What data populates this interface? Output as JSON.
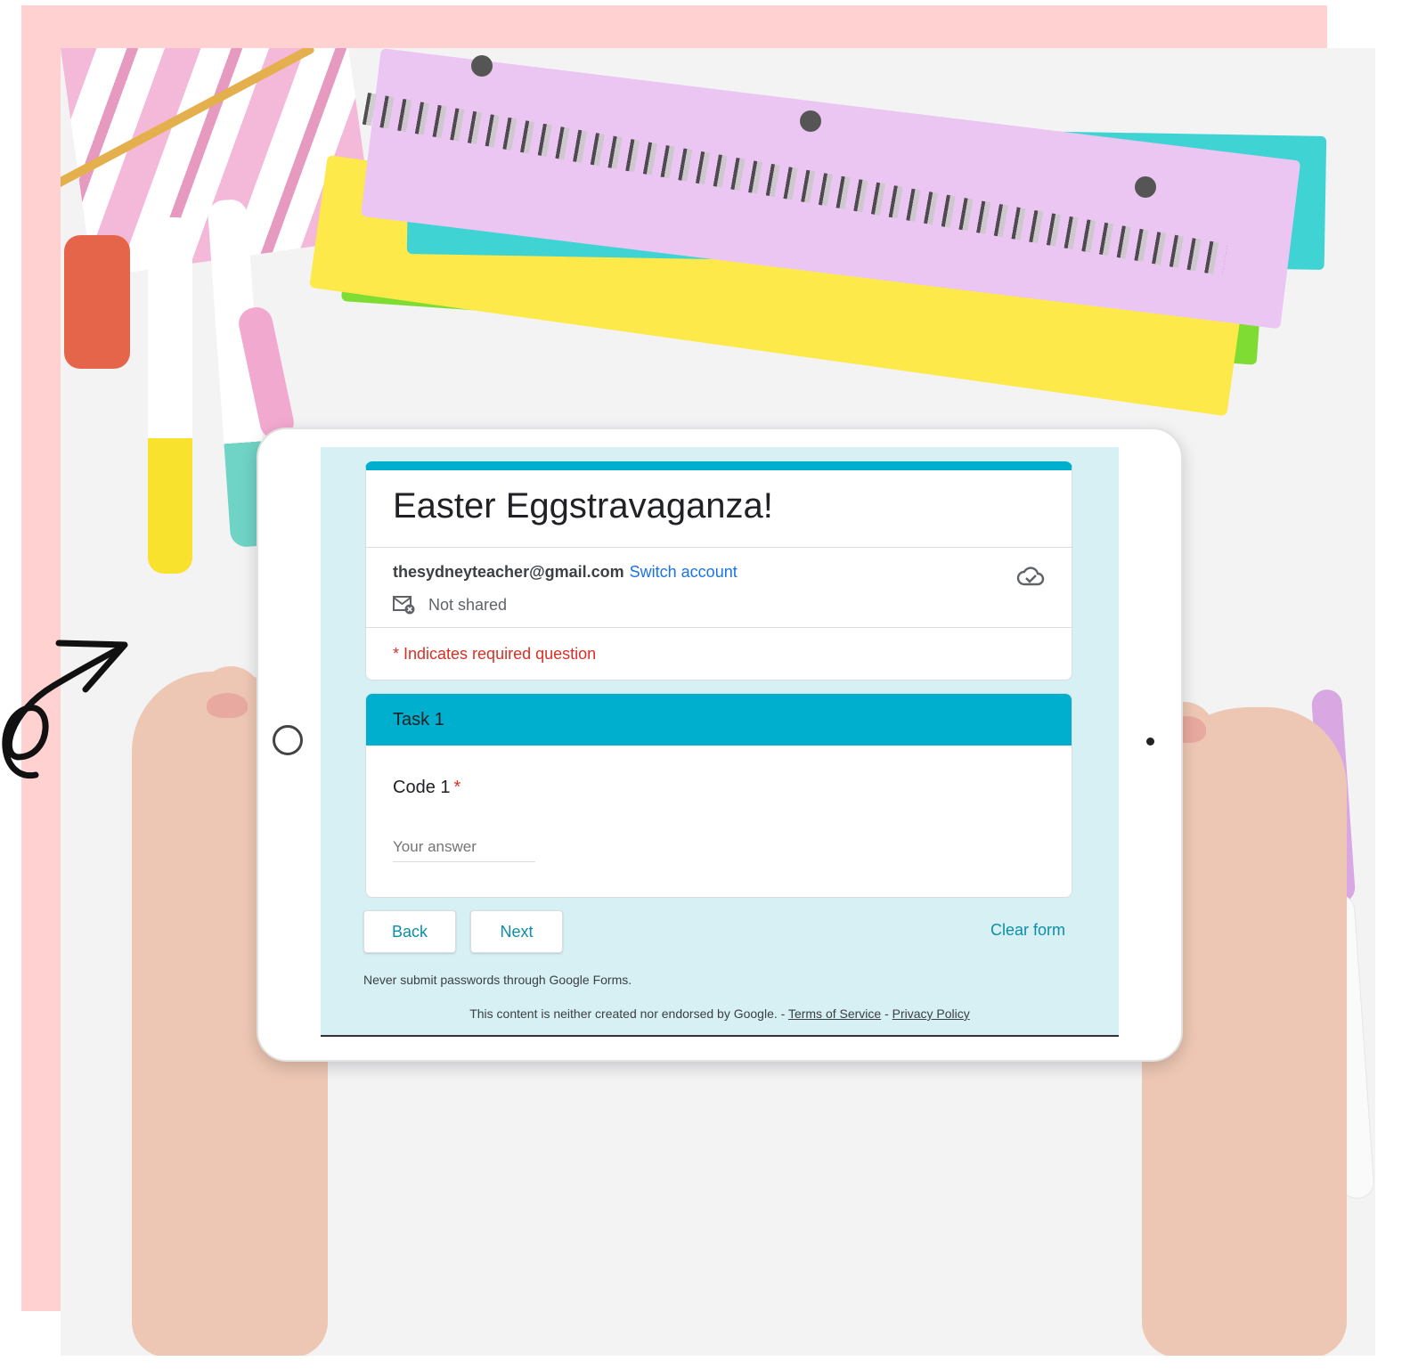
{
  "form": {
    "title": "Easter Eggstravaganza!",
    "account_email": "thesydneyteacher@gmail.com",
    "switch_account": "Switch account",
    "not_shared": "Not shared",
    "required_note": "* Indicates required question"
  },
  "section": {
    "title": "Task 1",
    "question_label": "Code 1",
    "required_mark": "*",
    "answer_placeholder": "Your answer"
  },
  "buttons": {
    "back": "Back",
    "next": "Next",
    "clear": "Clear form"
  },
  "footer": {
    "password_warning": "Never submit passwords through Google Forms.",
    "disclaimer": "This content is neither created nor endorsed by Google. - ",
    "terms": "Terms of Service",
    "separator": " - ",
    "privacy": "Privacy Policy"
  },
  "colors": {
    "accent": "#00aece",
    "background": "#d6f0f3",
    "link": "#1a73e8",
    "required": "#d93025",
    "frame": "#ffd1d1"
  },
  "icons": [
    "cloud-check-icon",
    "mail-not-shared-icon",
    "hand-drawn-arrow-icon"
  ]
}
